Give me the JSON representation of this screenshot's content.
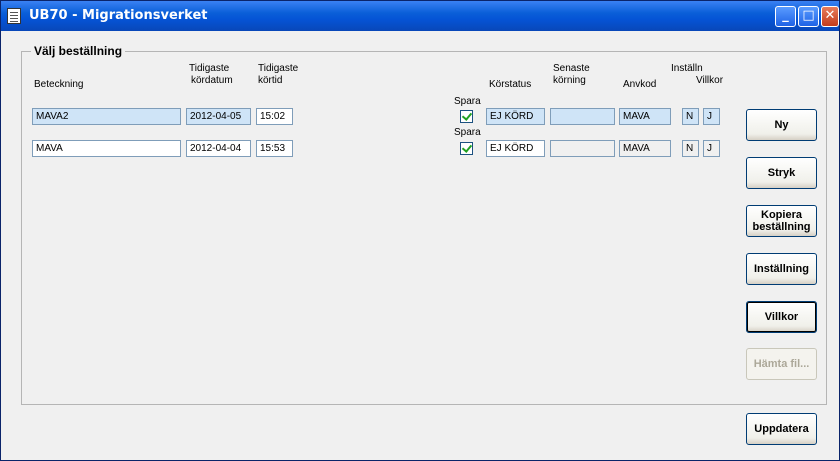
{
  "window": {
    "title": "UB70 - Migrationsverket"
  },
  "group": {
    "title": "Välj beställning"
  },
  "headers": {
    "beteckning": "Beteckning",
    "tidigaste_kordatum_1": "Tidigaste",
    "tidigaste_kordatum_2": "kördatum",
    "tidigaste_kortid_1": "Tidigaste",
    "tidigaste_kortid_2": "körtid",
    "spara": "Spara",
    "korstatus": "Körstatus",
    "senaste_1": "Senaste",
    "senaste_2": "körning",
    "anvkod": "Anvkod",
    "installn": "Inställn",
    "villkor": "Villkor"
  },
  "rows": [
    {
      "beteckning": "MAVA2",
      "datum": "2012-04-05",
      "tid": "15:02",
      "spara_label": "Spara",
      "spara": true,
      "korstatus": "EJ KÖRD",
      "senaste": "",
      "anvkod": "MAVA",
      "installn": "N",
      "villkor": "J"
    },
    {
      "beteckning": "MAVA",
      "datum": "2012-04-04",
      "tid": "15:53",
      "spara_label": "Spara",
      "spara": true,
      "korstatus": "EJ KÖRD",
      "senaste": "",
      "anvkod": "MAVA",
      "installn": "N",
      "villkor": "J"
    }
  ],
  "buttons": {
    "ny": "Ny",
    "stryk": "Stryk",
    "kopiera_1": "Kopiera",
    "kopiera_2": "beställning",
    "installning": "Inställning",
    "villkor": "Villkor",
    "hamta": "Hämta fil...",
    "uppdatera": "Uppdatera"
  },
  "titlebar_buttons": {
    "minimize": "_",
    "maximize": "□",
    "close": "✕"
  }
}
